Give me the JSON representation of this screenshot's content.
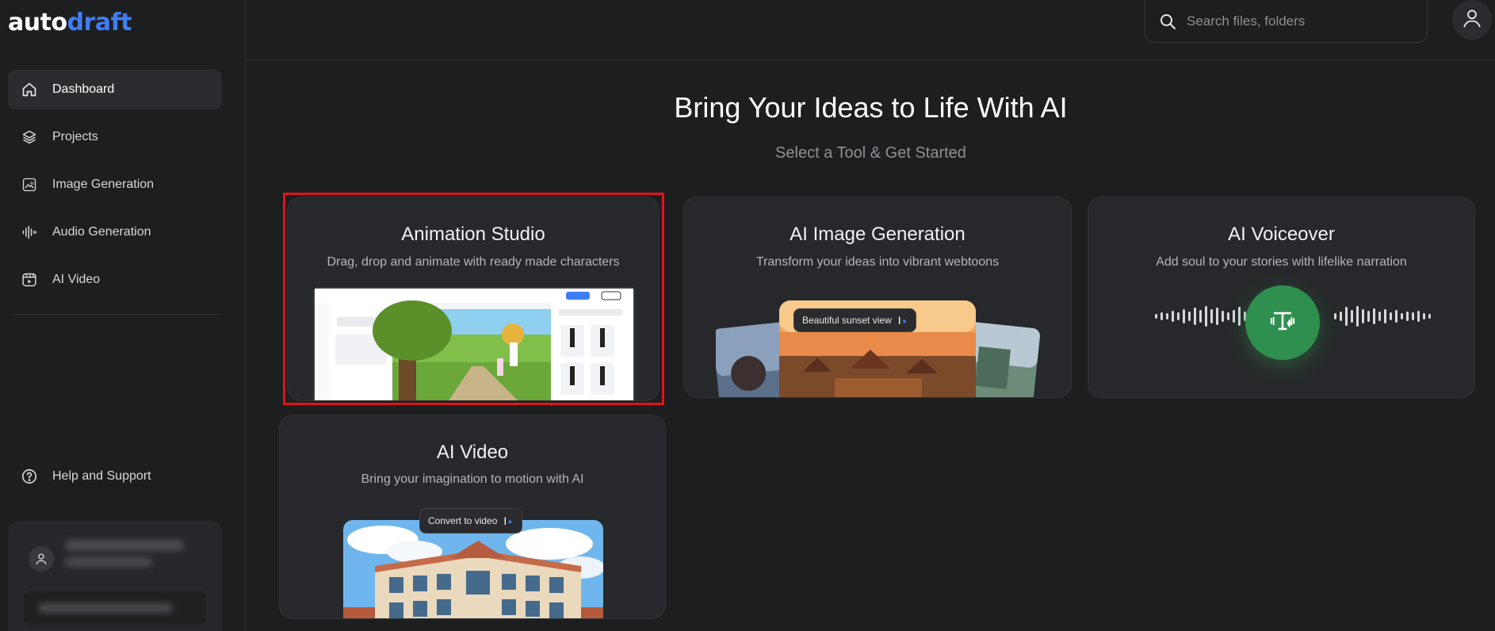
{
  "brand": {
    "part1": "auto",
    "part2": "draft"
  },
  "sidebar": {
    "items": [
      {
        "label": "Dashboard",
        "icon": "home-icon",
        "active": true
      },
      {
        "label": "Projects",
        "icon": "layers-icon"
      },
      {
        "label": "Image Generation",
        "icon": "ai-image-icon"
      },
      {
        "label": "Audio Generation",
        "icon": "audio-wave-icon"
      },
      {
        "label": "AI Video",
        "icon": "video-icon"
      }
    ],
    "help_label": "Help and Support"
  },
  "search": {
    "placeholder": "Search files, folders"
  },
  "hero": {
    "title": "Bring Your Ideas to Life With AI",
    "subtitle": "Select a Tool & Get Started"
  },
  "cards": [
    {
      "title": "Animation Studio",
      "desc": "Drag, drop and animate with ready made characters"
    },
    {
      "title": "AI Image Generation",
      "desc": "Transform your ideas into vibrant webtoons",
      "tooltip": "Beautiful sunset view"
    },
    {
      "title": "AI Voiceover",
      "desc": "Add soul to your stories with lifelike narration"
    },
    {
      "title": "AI Video",
      "desc": "Bring your imagination to motion with AI",
      "tooltip": "Convert to video"
    }
  ],
  "colors": {
    "accent": "#3f7df4",
    "highlight": "#e0141a",
    "voice_green": "#2f8f4e"
  }
}
